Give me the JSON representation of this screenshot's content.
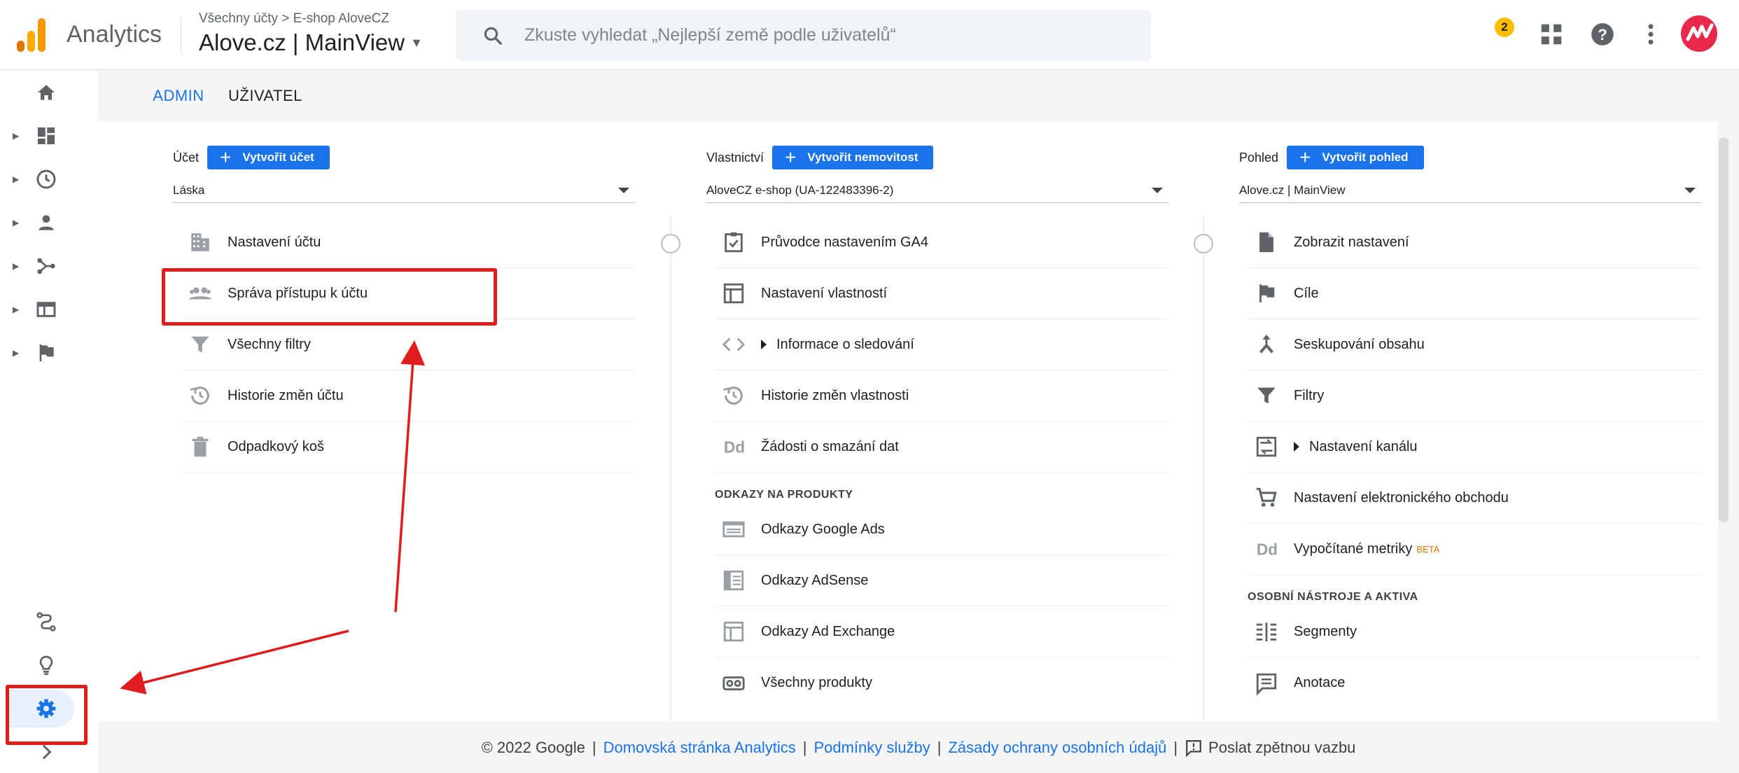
{
  "header": {
    "brand": "Analytics",
    "breadcrumb": "Všechny účty > E-shop AloveCZ",
    "view_title": "Alove.cz | MainView",
    "search_placeholder": "Zkuste vyhledat „Nejlepší země podle uživatelů“",
    "notifications_count": "2"
  },
  "tabs": [
    {
      "label": "ADMIN",
      "active": true
    },
    {
      "label": "UŽIVATEL",
      "active": false
    }
  ],
  "columns": {
    "account": {
      "label": "Účet",
      "create_button": "Vytvořit účet",
      "selected": "Láska",
      "items": [
        {
          "label": "Nastavení účtu",
          "icon": "building-icon"
        },
        {
          "label": "Správa přístupu k účtu",
          "icon": "people-icon"
        },
        {
          "label": "Všechny filtry",
          "icon": "filter-icon"
        },
        {
          "label": "Historie změn účtu",
          "icon": "history-icon"
        },
        {
          "label": "Odpadkový koš",
          "icon": "trash-icon"
        }
      ]
    },
    "property": {
      "label": "Vlastnictví",
      "create_button": "Vytvořit nemovitost",
      "selected": "AloveCZ e-shop (UA-122483396-2)",
      "items": [
        {
          "label": "Průvodce nastavením GA4",
          "icon": "checklist-icon"
        },
        {
          "label": "Nastavení vlastností",
          "icon": "window-icon"
        },
        {
          "label": "Informace o sledování",
          "icon": "code-icon"
        },
        {
          "label": "Historie změn vlastnosti",
          "icon": "history-icon"
        },
        {
          "label": "Žádosti o smazání dat",
          "icon": "dd-icon"
        }
      ],
      "section": "ODKAZY NA PRODUKTY",
      "links": [
        {
          "label": "Odkazy Google Ads",
          "icon": "ads-icon"
        },
        {
          "label": "Odkazy AdSense",
          "icon": "adsense-icon"
        },
        {
          "label": "Odkazy Ad Exchange",
          "icon": "window-icon"
        },
        {
          "label": "Všechny produkty",
          "icon": "link-icon"
        }
      ]
    },
    "view": {
      "label": "Pohled",
      "create_button": "Vytvořit pohled",
      "selected": "Alove.cz | MainView",
      "items": [
        {
          "label": "Zobrazit nastavení",
          "icon": "document-icon"
        },
        {
          "label": "Cíle",
          "icon": "flag-icon"
        },
        {
          "label": "Seskupování obsahu",
          "icon": "merge-icon"
        },
        {
          "label": "Filtry",
          "icon": "filter-icon"
        },
        {
          "label": "Nastavení kanálu",
          "icon": "channel-icon"
        },
        {
          "label": "Nastavení elektronického obchodu",
          "icon": "cart-icon"
        },
        {
          "label": "Vypočítané metriky",
          "icon": "dd-icon",
          "badge": "BETA"
        }
      ],
      "section": "OSOBNÍ NÁSTROJE A AKTIVA",
      "tools": [
        {
          "label": "Segmenty",
          "icon": "segments-icon"
        },
        {
          "label": "Anotace",
          "icon": "comment-icon"
        }
      ]
    }
  },
  "footer": {
    "copyright": "© 2022 Google",
    "link_home": "Domovská stránka Analytics",
    "link_terms": "Podmínky služby",
    "link_privacy": "Zásady ochrany osobních údajů",
    "feedback": "Poslat zpětnou vazbu",
    "separator": "|"
  },
  "colors": {
    "accent": "#1a73e8",
    "annotation": "#e01c1c",
    "tab_underline": "#f29900"
  }
}
